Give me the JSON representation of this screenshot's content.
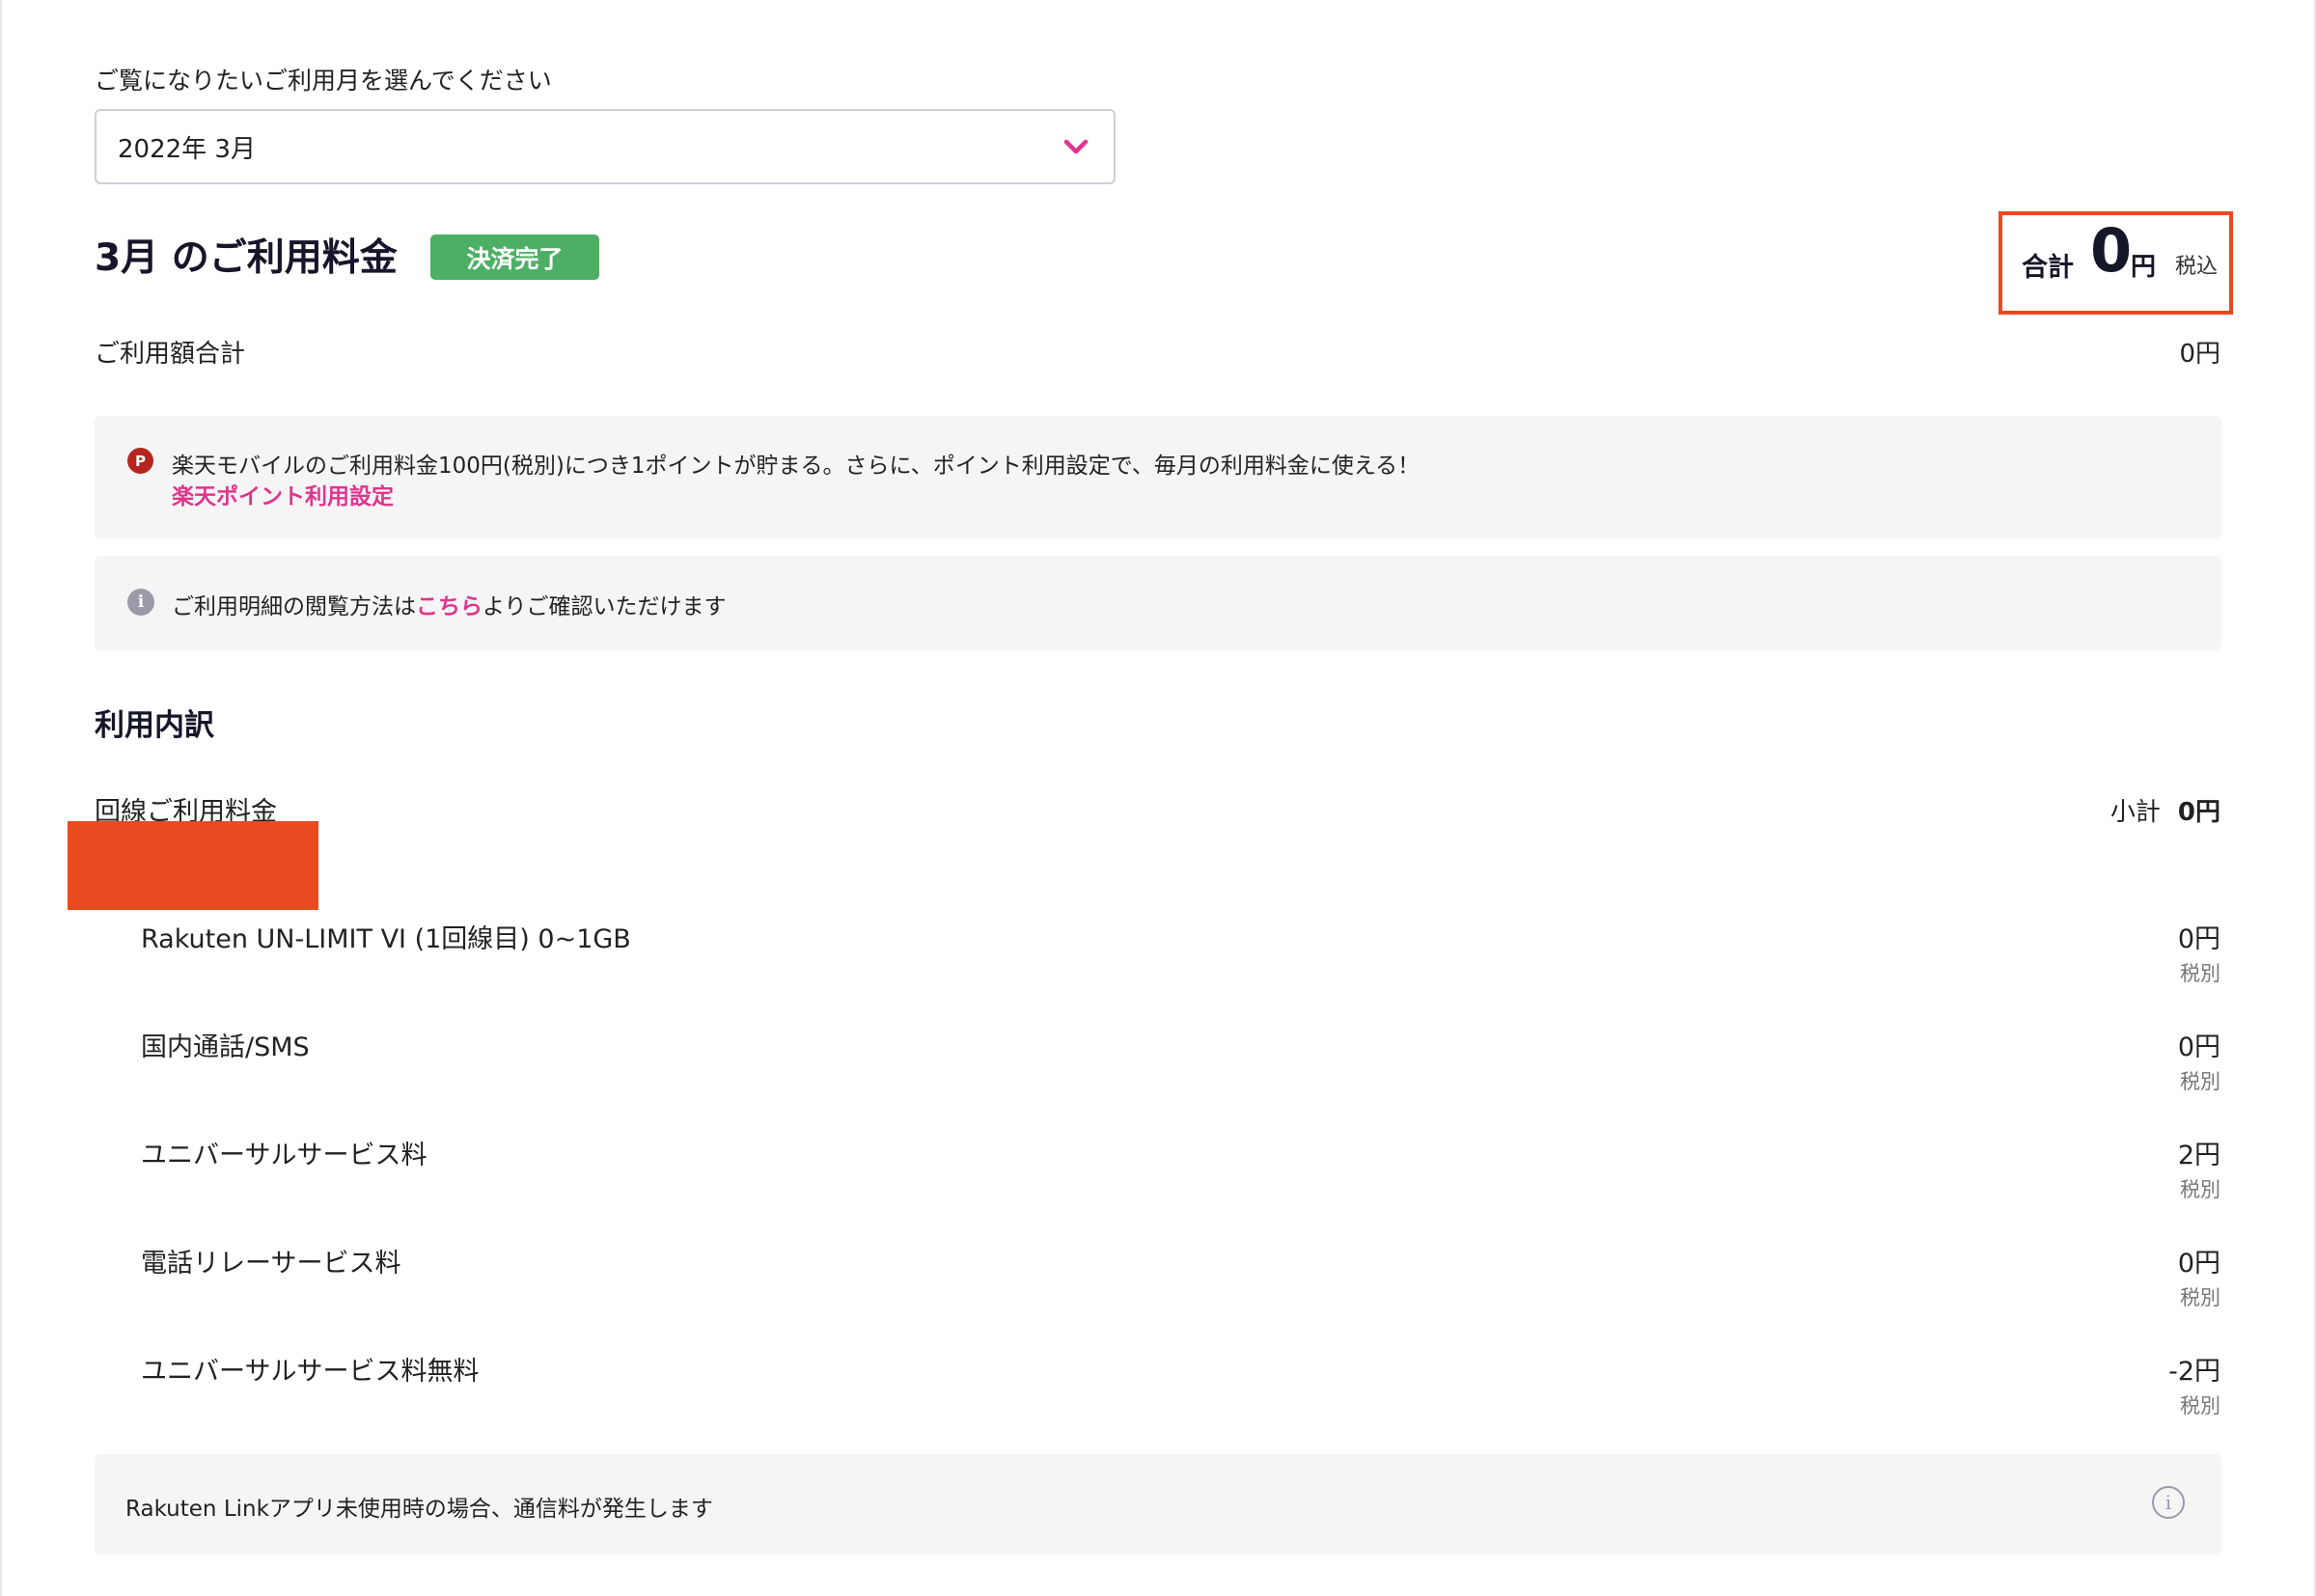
{
  "month_selector": {
    "label": "ご覧になりたいご利用月を選んでください",
    "selected": "2022年 3月",
    "icon": "chevron-down-icon"
  },
  "summary": {
    "title": "3月 のご利用料金",
    "status_badge": "決済完了",
    "total_label": "合計",
    "total_value": "0",
    "total_unit": "円",
    "total_tax_note": "税込",
    "usage_total_label": "ご利用額合計",
    "usage_total_value": "0円"
  },
  "notices": {
    "points_icon": "P",
    "points_text": "楽天モバイルのご利用料金100円(税別)につき1ポイントが貯まる。さらに、ポイント利用設定で、毎月の利用料金に使える！",
    "points_link": "楽天ポイント利用設定",
    "help_icon": "i",
    "help_prefix": "ご利用明細の閲覧方法は",
    "help_link": "こちら",
    "help_suffix": "よりご確認いただけます"
  },
  "breakdown": {
    "title": "利用内訳",
    "line_title": "回線ご利用料金",
    "subtotal_label": "小計",
    "subtotal_value": "0円",
    "items": [
      {
        "name": "Rakuten UN-LIMIT VI (1回線目) 0~1GB",
        "price": "0円",
        "tax": "税別"
      },
      {
        "name": "国内通話/SMS",
        "price": "0円",
        "tax": "税別"
      },
      {
        "name": "ユニバーサルサービス料",
        "price": "2円",
        "tax": "税別"
      },
      {
        "name": "電話リレーサービス料",
        "price": "0円",
        "tax": "税別"
      },
      {
        "name": "ユニバーサルサービス料無料",
        "price": "-2円",
        "tax": "税別"
      }
    ]
  },
  "link_notice": {
    "text": "Rakuten Linkアプリ未使用時の場合、通信料が発生します",
    "icon": "i"
  },
  "colors": {
    "accent_pink": "#e0358d",
    "badge_green": "#4caf64",
    "highlight_orange": "#e84b1f",
    "points_red": "#b6261f"
  }
}
